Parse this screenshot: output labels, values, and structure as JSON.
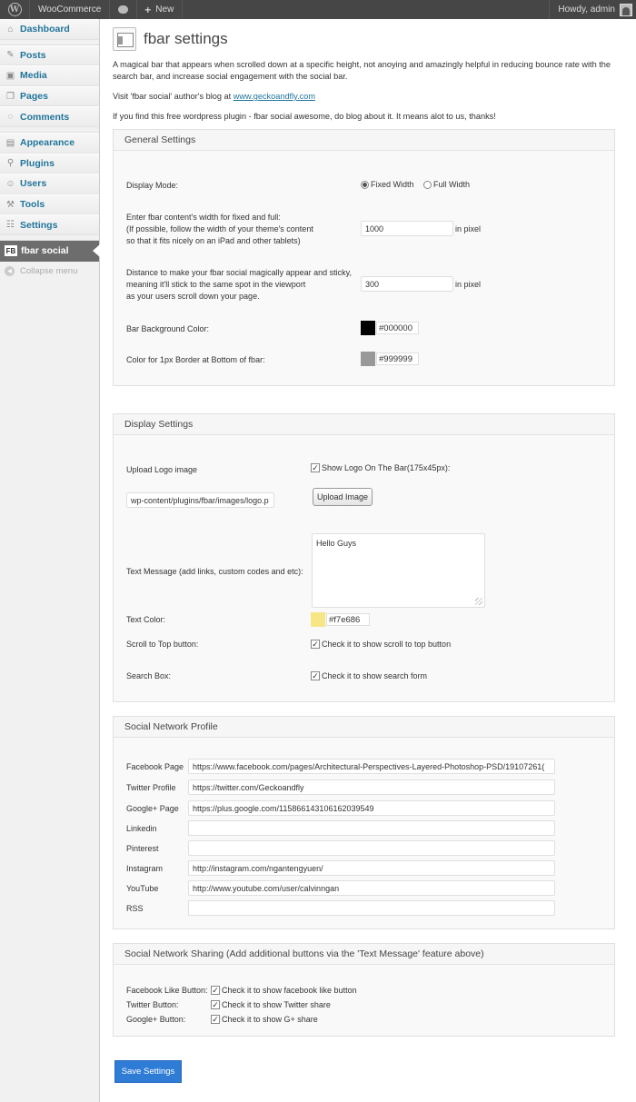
{
  "adminbar": {
    "site_name": "WooCommerce",
    "new_label": "New",
    "howdy": "Howdy, admin"
  },
  "sidebar": {
    "items": [
      {
        "label": "Dashboard",
        "icon": "dashboard-icon"
      },
      {
        "label": "Posts",
        "icon": "pin-icon"
      },
      {
        "label": "Media",
        "icon": "media-icon"
      },
      {
        "label": "Pages",
        "icon": "pages-icon"
      },
      {
        "label": "Comments",
        "icon": "comment-icon"
      },
      {
        "label": "Appearance",
        "icon": "appearance-icon"
      },
      {
        "label": "Plugins",
        "icon": "plugin-icon"
      },
      {
        "label": "Users",
        "icon": "users-icon"
      },
      {
        "label": "Tools",
        "icon": "tools-icon"
      },
      {
        "label": "Settings",
        "icon": "settings-icon"
      },
      {
        "label": "fbar social",
        "icon": "fb-icon",
        "icon_text": "FB"
      }
    ],
    "collapse": "Collapse menu"
  },
  "page": {
    "title": "fbar settings",
    "intro1": "A magical bar that appears when scrolled down at a specific height, not anoying and amazingly helpful in reducing bounce rate with the search bar, and increase social engagement with the social bar.",
    "intro2_prefix": "Visit 'fbar social' author's blog at ",
    "intro2_link": "www.geckoandfly.com",
    "intro3": "If you find this free wordpress plugin - fbar social awesome, do blog about it. It means alot to us, thanks!"
  },
  "general": {
    "title": "General Settings",
    "display_mode_label": "Display Mode:",
    "fixed_width": "Fixed Width",
    "full_width": "Full Width",
    "width_label_1": "Enter fbar content's width for fixed and full:",
    "width_label_2": "(If possible, follow the width of your theme's content",
    "width_label_3": "so that it fits nicely on an iPad and other tablets)",
    "width_value": "1000",
    "width_suffix": "in pixel",
    "distance_label_1": "Distance to make your fbar social magically appear and sticky,",
    "distance_label_2": "meaning it'll stick to the same spot in the viewport",
    "distance_label_3": "as your users scroll down your page.",
    "distance_value": "300",
    "distance_suffix": "in pixel",
    "bg_color_label": "Bar Background Color:",
    "bg_color_value": "#000000",
    "border_color_label": "Color for 1px Border at Bottom of fbar:",
    "border_color_value": "#999999"
  },
  "display": {
    "title": "Display Settings",
    "upload_label": "Upload Logo image",
    "show_logo": "Show Logo On The Bar(175x45px):",
    "logo_path": "wp-content/plugins/fbar/images/logo.p",
    "upload_button": "Upload Image",
    "text_message_label": "Text Message (add links, custom codes and etc):",
    "text_message_value": "Hello Guys",
    "text_color_label": "Text Color:",
    "text_color_value": "#f7e686",
    "scroll_label": "Scroll to Top button:",
    "scroll_check": "Check it to show scroll to top button",
    "search_label": "Search Box:",
    "search_check": "Check it to show search form"
  },
  "social": {
    "title": "Social Network Profile",
    "rows": [
      {
        "label": "Facebook Page",
        "value": "https://www.facebook.com/pages/Architectural-Perspectives-Layered-Photoshop-PSD/19107261("
      },
      {
        "label": "Twitter Profile",
        "value": "https://twitter.com/Geckoandfly"
      },
      {
        "label": "Google+ Page",
        "value": "https://plus.google.com/115866143106162039549"
      },
      {
        "label": "Linkedin",
        "value": ""
      },
      {
        "label": "Pinterest",
        "value": ""
      },
      {
        "label": "Instagram",
        "value": "http://instagram.com/ngantengyuen/"
      },
      {
        "label": "YouTube",
        "value": "http://www.youtube.com/user/calvinngan"
      },
      {
        "label": "RSS",
        "value": ""
      }
    ]
  },
  "sharing": {
    "title": "Social Network Sharing (Add additional buttons via the 'Text Message' feature above)",
    "rows": [
      {
        "label": "Facebook Like Button:",
        "check": "Check it to show facebook like button"
      },
      {
        "label": "Twitter Button:",
        "check": "Check it to show Twitter share"
      },
      {
        "label": "Google+ Button:",
        "check": "Check it to show G+ share"
      }
    ]
  },
  "save_label": "Save Settings",
  "colors": {
    "swatch_bg": "#000000",
    "swatch_border": "#999999",
    "swatch_text": "#f7e686",
    "accent": "#21759b",
    "save_button": "#2e7cd6"
  }
}
